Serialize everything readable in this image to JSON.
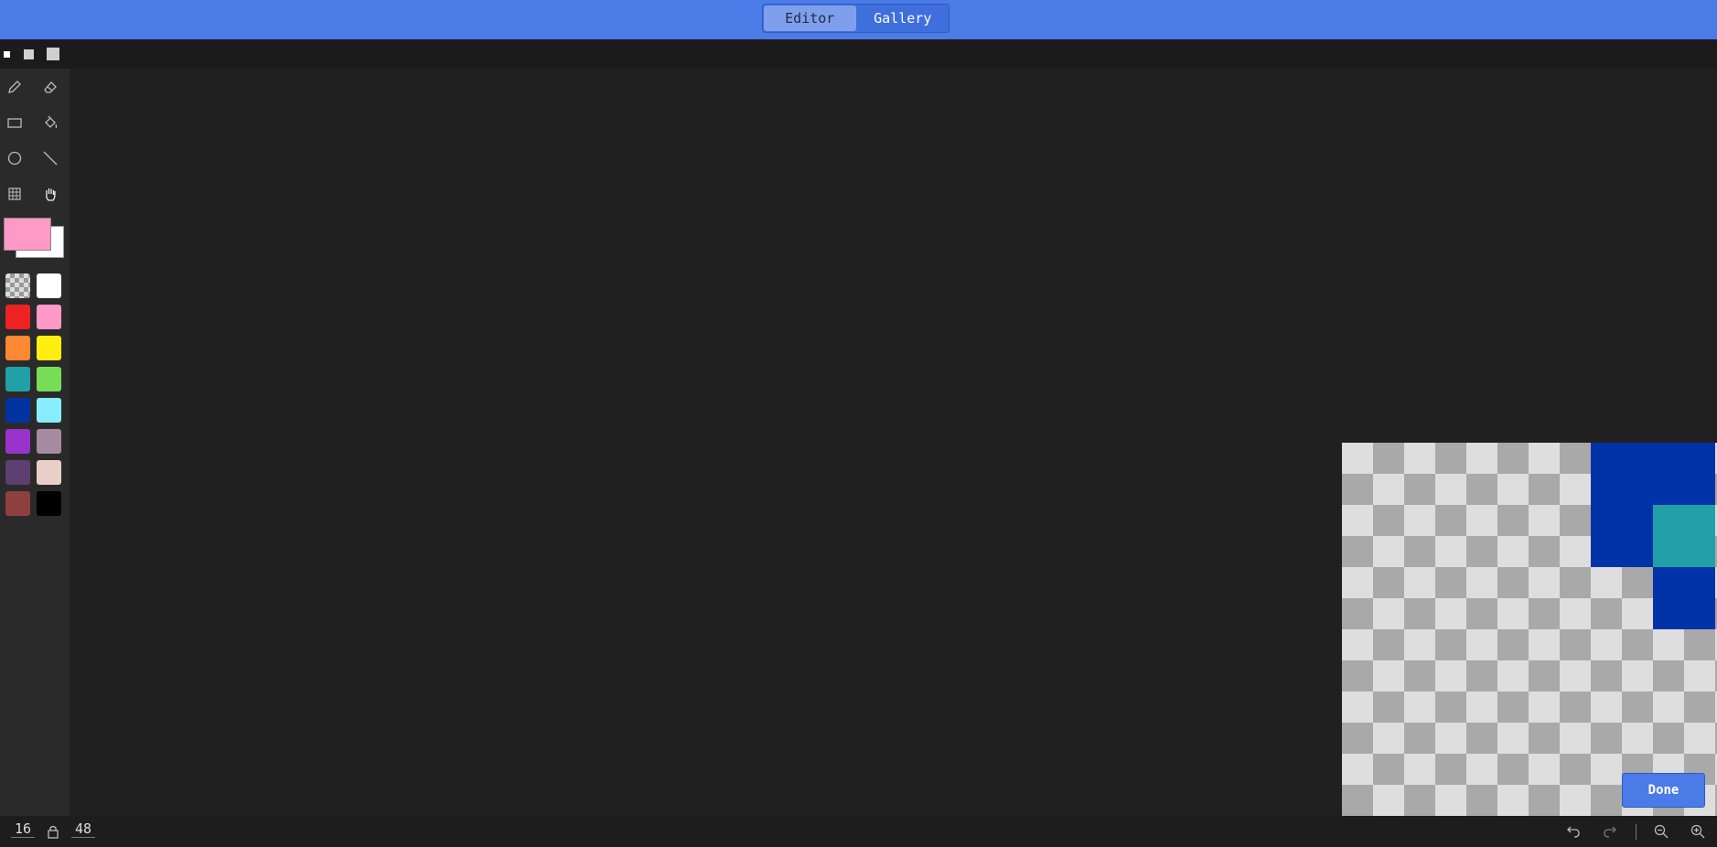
{
  "header": {
    "tabs": [
      {
        "label": "Editor",
        "active": true
      },
      {
        "label": "Gallery",
        "active": false
      }
    ],
    "accent_color": "#4a7be7"
  },
  "brush_sizes": [
    "small-brush-icon",
    "medium-brush-icon",
    "large-brush-icon"
  ],
  "tools": [
    "pencil-icon",
    "eraser-icon",
    "rectangle-icon",
    "fill-bucket-icon",
    "circle-icon",
    "line-icon",
    "grid-icon",
    "hand-icon"
  ],
  "colors": {
    "primary": "#ff99c8",
    "secondary": "#ffffff",
    "palette": [
      "transparent",
      "#ffffff",
      "#ee2222",
      "#ff99c8",
      "#ff8833",
      "#ffee11",
      "#22a0a8",
      "#77dd55",
      "#0033a0",
      "#88eeff",
      "#9933cc",
      "#a68aa0",
      "#5c3f70",
      "#e8d0c8",
      "#8e4040",
      "#000000"
    ]
  },
  "canvas": {
    "painted_cells": [
      {
        "col": 8,
        "row": 0,
        "color": "#0033a8"
      },
      {
        "col": 9,
        "row": 0,
        "color": "#0033a8"
      },
      {
        "col": 10,
        "row": 0,
        "color": "#0033a8"
      },
      {
        "col": 11,
        "row": 0,
        "color": "#0033a8"
      },
      {
        "col": 8,
        "row": 1,
        "color": "#0033a8"
      },
      {
        "col": 9,
        "row": 1,
        "color": "#0033a8"
      },
      {
        "col": 10,
        "row": 1,
        "color": "#0033a8"
      },
      {
        "col": 11,
        "row": 1,
        "color": "#0033a8"
      },
      {
        "col": 8,
        "row": 2,
        "color": "#0033a8"
      },
      {
        "col": 9,
        "row": 2,
        "color": "#0033a8"
      },
      {
        "col": 10,
        "row": 2,
        "color": "#229fa8"
      },
      {
        "col": 11,
        "row": 2,
        "color": "#229fa8"
      },
      {
        "col": 8,
        "row": 3,
        "color": "#0033a8"
      },
      {
        "col": 9,
        "row": 3,
        "color": "#0033a8"
      },
      {
        "col": 10,
        "row": 3,
        "color": "#229fa8"
      },
      {
        "col": 11,
        "row": 3,
        "color": "#229fa8"
      },
      {
        "col": 10,
        "row": 4,
        "color": "#0033a8"
      },
      {
        "col": 11,
        "row": 4,
        "color": "#0033a8"
      },
      {
        "col": 10,
        "row": 5,
        "color": "#0033a8"
      },
      {
        "col": 11,
        "row": 5,
        "color": "#0033a8"
      }
    ],
    "done_label": "Done"
  },
  "footer": {
    "width_value": "16",
    "height_value": "48",
    "icons": [
      "lock-icon",
      "undo-icon",
      "redo-icon",
      "zoom-out-icon",
      "zoom-in-icon"
    ]
  }
}
